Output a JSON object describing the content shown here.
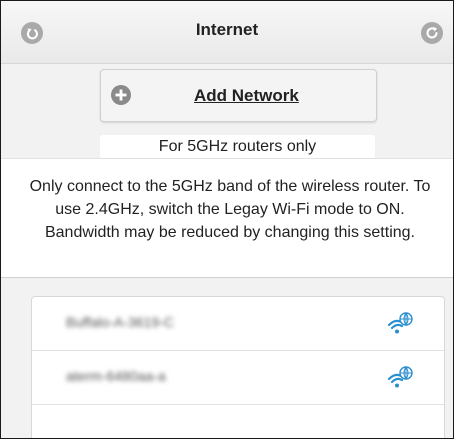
{
  "header": {
    "title": "Internet",
    "back_icon": "back-arrow-icon",
    "refresh_icon": "refresh-icon"
  },
  "add_network": {
    "label": "Add Network",
    "icon": "plus-circle-icon"
  },
  "band_note": "For 5GHz routers only",
  "description": "Only connect to the 5GHz band of the wireless router. To use 2.4GHz, switch the Legay Wi-Fi mode to ON. Bandwidth may be reduced by changing this setting.",
  "networks": [
    {
      "ssid": "Buffalo-A-3619-C",
      "icon": "wifi-globe-icon"
    },
    {
      "ssid": "aterm-6480aa-a",
      "icon": "wifi-globe-icon"
    }
  ],
  "colors": {
    "accent": "#2a8fd0",
    "icon_gray": "#a9a9a9"
  }
}
